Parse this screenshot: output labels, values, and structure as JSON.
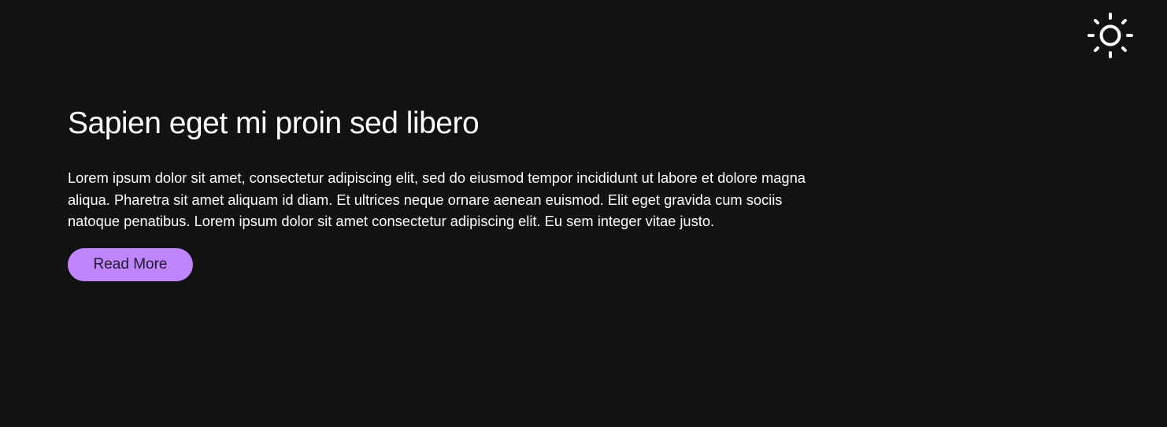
{
  "header": {
    "theme_toggle_icon": "sun-icon"
  },
  "article": {
    "title": "Sapien eget mi proin sed libero",
    "body": "Lorem ipsum dolor sit amet, consectetur adipiscing elit, sed do eiusmod tempor incididunt ut labore et dolore magna aliqua. Pharetra sit amet aliquam id diam. Et ultrices neque ornare aenean euismod. Elit eget gravida cum sociis natoque penatibus. Lorem ipsum dolor sit amet consectetur adipiscing elit. Eu sem integer vitae justo.",
    "read_more_label": "Read More"
  },
  "colors": {
    "background": "#121212",
    "accent": "#c084fc",
    "text": "#ffffff"
  }
}
